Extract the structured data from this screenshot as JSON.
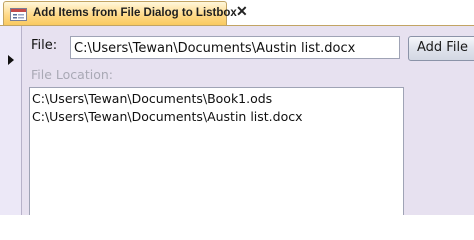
{
  "tab": {
    "title": "Add Items from File Dialog to Listbox",
    "close_symbol": "✕",
    "icon": "form-icon"
  },
  "record_selector": {
    "icon": "current-record-arrow-icon"
  },
  "form": {
    "file_label": "File:",
    "file_value": "C:\\Users\\Tewan\\Documents\\Austin list.docx",
    "add_button_label": "Add File",
    "location_label": "File Location:",
    "list_items": [
      "C:\\Users\\Tewan\\Documents\\Book1.ods",
      "C:\\Users\\Tewan\\Documents\\Austin list.docx"
    ]
  },
  "colors": {
    "tab_active": "#ffd987",
    "form_background": "#e7e1f0",
    "disabled_label": "#a9a9b5"
  }
}
